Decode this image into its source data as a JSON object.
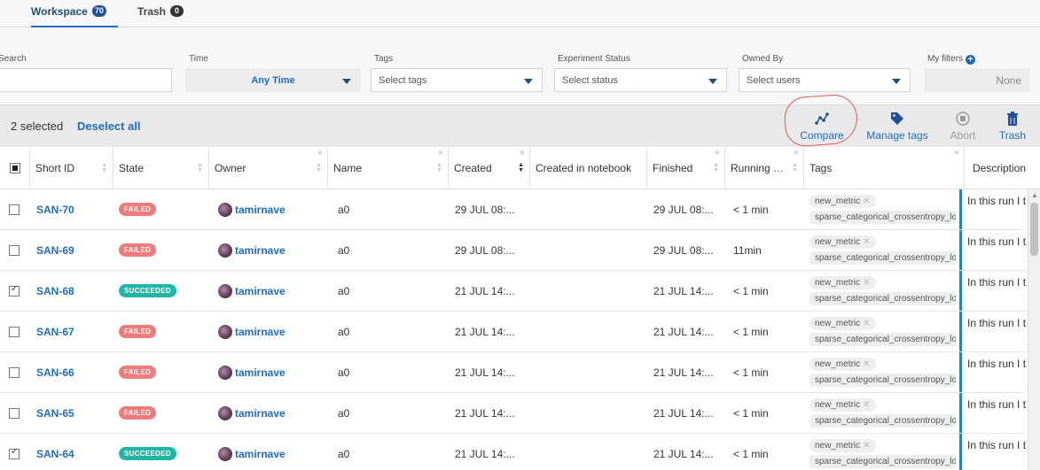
{
  "tabs": [
    {
      "label": "Workspace",
      "count": "70"
    },
    {
      "label": "Trash",
      "count": "0"
    }
  ],
  "filters": {
    "search_label": "Search",
    "search_value": "",
    "time_label": "Time",
    "time_value": "Any Time",
    "tags_label": "Tags",
    "tags_placeholder": "Select tags",
    "status_label": "Experiment Status",
    "status_placeholder": "Select status",
    "owned_label": "Owned By",
    "owned_placeholder": "Select users",
    "my_filters_label": "My filters",
    "my_filters_value": "None"
  },
  "actionbar": {
    "selected_text": "2 selected",
    "deselect_label": "Deselect all",
    "compare_label": "Compare",
    "manage_tags_label": "Manage tags",
    "abort_label": "Abort",
    "trash_label": "Trash"
  },
  "columns": {
    "short_id": "Short ID",
    "state": "State",
    "owner": "Owner",
    "name": "Name",
    "created": "Created",
    "created_in_notebook": "Created in notebook",
    "finished": "Finished",
    "running": "Running …",
    "tags": "Tags",
    "description": "Description"
  },
  "colors": {
    "failed": "#f07b7b",
    "succeeded": "#1fb6a6",
    "accent": "#1f6cc0"
  },
  "rows": [
    {
      "id": "SAN-70",
      "state": "FAILED",
      "checked": false,
      "owner": "tamirnave",
      "name": "a0",
      "created": "29 JUL 08:...",
      "notebook": "",
      "finished": "29 JUL 08:...",
      "running": "< 1 min",
      "tag1": "new_metric",
      "tag2": "sparse_categorical_crossentropy_loss",
      "desc": "In this run I t"
    },
    {
      "id": "SAN-69",
      "state": "FAILED",
      "checked": false,
      "owner": "tamirnave",
      "name": "a0",
      "created": "29 JUL 08:...",
      "notebook": "",
      "finished": "29 JUL 08:...",
      "running": "11min",
      "tag1": "new_metric",
      "tag2": "sparse_categorical_crossentropy_loss",
      "desc": "In this run I t"
    },
    {
      "id": "SAN-68",
      "state": "SUCCEEDED",
      "checked": true,
      "owner": "tamirnave",
      "name": "a0",
      "created": "21 JUL 14:...",
      "notebook": "",
      "finished": "21 JUL 14:...",
      "running": "< 1 min",
      "tag1": "new_metric",
      "tag2": "sparse_categorical_crossentropy_loss",
      "desc": "In this run I t"
    },
    {
      "id": "SAN-67",
      "state": "FAILED",
      "checked": false,
      "owner": "tamirnave",
      "name": "a0",
      "created": "21 JUL 14:...",
      "notebook": "",
      "finished": "21 JUL 14:...",
      "running": "< 1 min",
      "tag1": "new_metric",
      "tag2": "sparse_categorical_crossentropy_loss",
      "desc": "In this run I t"
    },
    {
      "id": "SAN-66",
      "state": "FAILED",
      "checked": false,
      "owner": "tamirnave",
      "name": "a0",
      "created": "21 JUL 14:...",
      "notebook": "",
      "finished": "21 JUL 14:...",
      "running": "< 1 min",
      "tag1": "new_metric",
      "tag2": "sparse_categorical_crossentropy_loss",
      "desc": "In this run I t"
    },
    {
      "id": "SAN-65",
      "state": "FAILED",
      "checked": false,
      "owner": "tamirnave",
      "name": "a0",
      "created": "21 JUL 14:...",
      "notebook": "",
      "finished": "21 JUL 14:...",
      "running": "< 1 min",
      "tag1": "new_metric",
      "tag2": "sparse_categorical_crossentropy_loss",
      "desc": "In this run I t"
    },
    {
      "id": "SAN-64",
      "state": "SUCCEEDED",
      "checked": true,
      "owner": "tamirnave",
      "name": "a0",
      "created": "21 JUL 14:...",
      "notebook": "",
      "finished": "21 JUL 14:...",
      "running": "< 1 min",
      "tag1": "new_metric",
      "tag2": "sparse_categorical_crossentropy_loss",
      "desc": "In this run I t"
    }
  ]
}
